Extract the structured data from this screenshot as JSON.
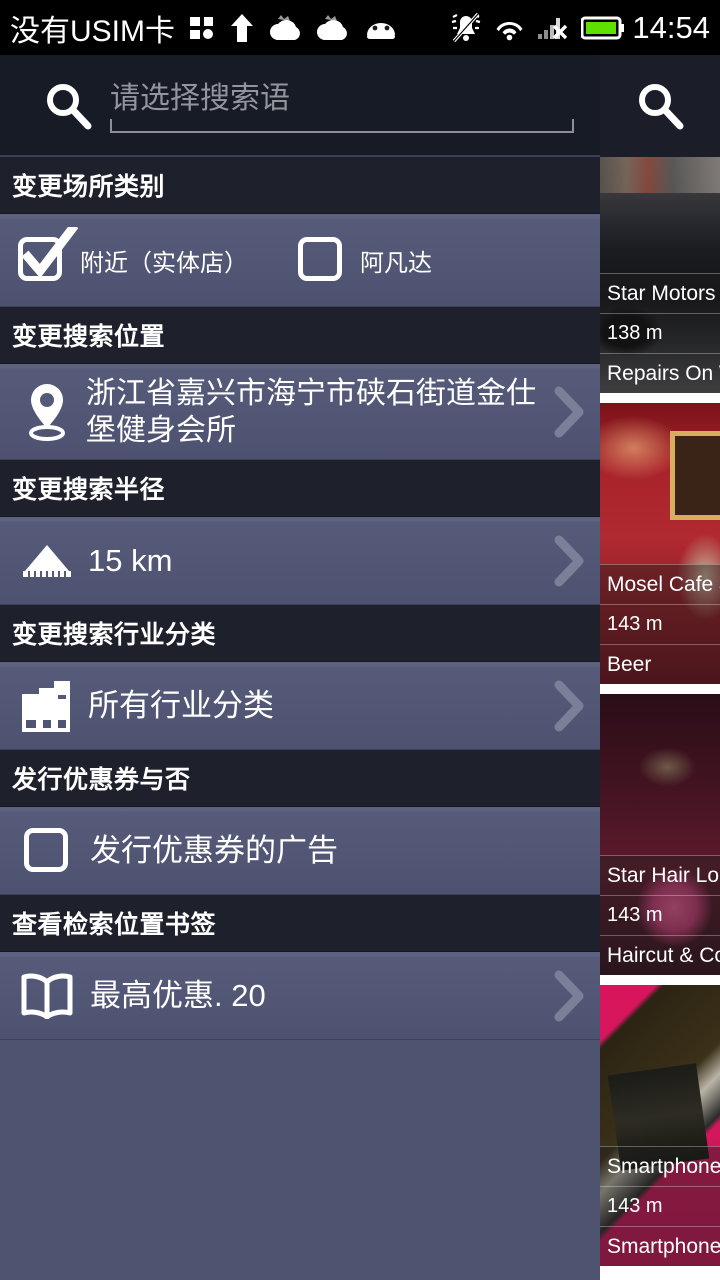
{
  "statusbar": {
    "carrier": "没有USIM卡",
    "time": "14:54",
    "icons_left": [
      "grid-icon",
      "upload-arrow-icon",
      "cloud-icon",
      "cloud-icon",
      "android-icon"
    ],
    "icons_right": [
      "silent-bell-icon",
      "wifi-icon",
      "signal-no-service-icon",
      "battery-icon"
    ],
    "battery_color": "#5ee000"
  },
  "search": {
    "placeholder": "请选择搜索语",
    "value": "",
    "icon": "search-icon"
  },
  "sections": [
    {
      "header": "变更场所类别",
      "type": "checkboxes",
      "checkboxes": [
        {
          "label": "附近（实体店）",
          "checked": true
        },
        {
          "label": "阿凡达",
          "checked": false
        }
      ]
    },
    {
      "header": "变更搜索位置",
      "type": "value",
      "icon": "map-pin-icon",
      "value": "浙江省嘉兴市海宁市硖石街道金仕堡健身会所",
      "chevron": true
    },
    {
      "header": "变更搜索半径",
      "type": "value",
      "icon": "protractor-icon",
      "value": "15 km",
      "chevron": true
    },
    {
      "header": "变更搜索行业分类",
      "type": "value",
      "icon": "buildings-icon",
      "value": "所有行业分类",
      "chevron": true
    },
    {
      "header": "发行优惠券与否",
      "type": "checkbox-single",
      "checkbox": {
        "label": "发行优惠券的广告",
        "checked": false
      }
    },
    {
      "header": "查看检索位置书签",
      "type": "value",
      "icon": "open-book-icon",
      "value": "最高优惠. 20",
      "chevron": true
    }
  ],
  "results_panel": {
    "search_icon": "search-icon",
    "cards": [
      {
        "name": "Star Motors",
        "distance": "138 m",
        "category": "Repairs On Whee",
        "photo": "ph-car"
      },
      {
        "name": "Mosel Cafe & Lou",
        "distance": "143 m",
        "category": "Beer",
        "photo": "ph-cafe"
      },
      {
        "name": "Star Hair Lounge",
        "distance": "143 m",
        "category": "Haircut & Color",
        "photo": "ph-hair"
      },
      {
        "name": "Smartphone Rep",
        "distance": "143 m",
        "category": "Smartphone Rep",
        "photo": "ph-phone"
      }
    ]
  },
  "colors": {
    "panel_bg": "#4e5370",
    "row_bg": "#555a78",
    "header_bg": "#1e212c",
    "search_bg": "#171b26",
    "chevron": "#7b7f97",
    "accent_text": "#ffffff"
  }
}
